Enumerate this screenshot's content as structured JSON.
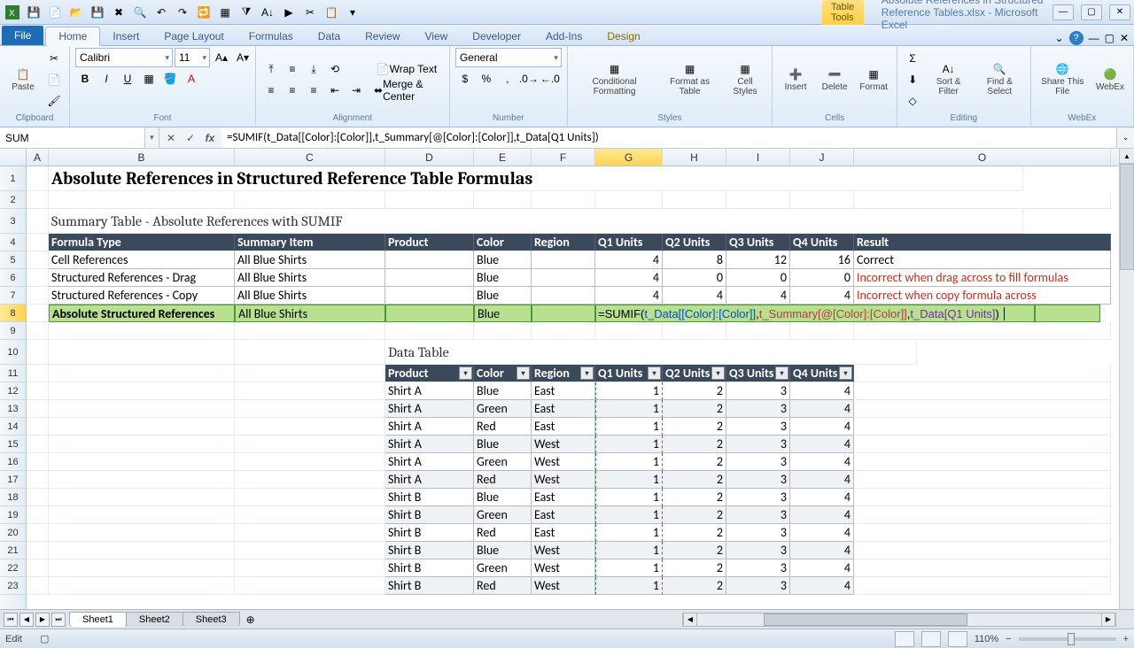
{
  "app": {
    "table_tools": "Table Tools",
    "doc_title": "Absolute References in Structured Reference Tables.xlsx - Microsoft Excel"
  },
  "tabs": {
    "file": "File",
    "home": "Home",
    "insert": "Insert",
    "page_layout": "Page Layout",
    "formulas": "Formulas",
    "data": "Data",
    "review": "Review",
    "view": "View",
    "developer": "Developer",
    "addins": "Add-Ins",
    "design": "Design"
  },
  "ribbon": {
    "clipboard": "Clipboard",
    "paste": "Paste",
    "font_group": "Font",
    "font_name": "Calibri",
    "font_size": "11",
    "alignment": "Alignment",
    "wrap": "Wrap Text",
    "merge": "Merge & Center",
    "number": "Number",
    "num_format": "General",
    "styles": "Styles",
    "cond_fmt": "Conditional\nFormatting",
    "fmt_table": "Format\nas Table",
    "cell_styles": "Cell\nStyles",
    "cells": "Cells",
    "insert": "Insert",
    "delete": "Delete",
    "format": "Format",
    "editing": "Editing",
    "sort": "Sort &\nFilter",
    "find": "Find &\nSelect",
    "webex_g": "WebEx",
    "share": "Share\nThis File",
    "webex": "WebEx"
  },
  "namebox": "SUM",
  "formula": "=SUMIF(t_Data[[Color]:[Color]],t_Summary[@[Color]:[Color]],t_Data[Q1 Units])",
  "columns": [
    "A",
    "B",
    "C",
    "D",
    "E",
    "F",
    "G",
    "H",
    "I",
    "J",
    "O"
  ],
  "title": "Absolute References in Structured Reference Table Formulas",
  "subtitle": "Summary Table - Absolute References with SUMIF",
  "summary": {
    "headers": [
      "Formula Type",
      "Summary Item",
      "Product",
      "Color",
      "Region",
      "Q1 Units",
      "Q2 Units",
      "Q3 Units",
      "Q4 Units",
      "Result"
    ],
    "rows": [
      {
        "type": "Cell References",
        "item": "All Blue Shirts",
        "product": "",
        "color": "Blue",
        "region": "",
        "q1": "4",
        "q2": "8",
        "q3": "12",
        "q4": "16",
        "result": "Correct",
        "red": false
      },
      {
        "type": "Structured References - Drag",
        "item": "All Blue Shirts",
        "product": "",
        "color": "Blue",
        "region": "",
        "q1": "4",
        "q2": "0",
        "q3": "0",
        "q4": "0",
        "result": "Incorrect when drag across to fill formulas",
        "red": true
      },
      {
        "type": "Structured References - Copy",
        "item": "All Blue Shirts",
        "product": "",
        "color": "Blue",
        "region": "",
        "q1": "4",
        "q2": "4",
        "q3": "4",
        "q4": "4",
        "result": "Incorrect when copy formula across",
        "red": true
      },
      {
        "type": "Absolute Structured References",
        "item": "All Blue Shirts",
        "product": "",
        "color": "Blue",
        "region": "",
        "q1": "",
        "q2": "",
        "q3": "",
        "q4": "",
        "result": "",
        "red": false
      }
    ]
  },
  "inline_formula": {
    "p1": "=SUMIF(",
    "p2": "t_Data[[Color]:[Color]]",
    "p3": ",",
    "p4": "t_Summary[@[Color]:[Color]]",
    "p5": ",",
    "p6": "t_Data[Q1 Units]",
    "p7": ")"
  },
  "data_title": "Data Table",
  "data_table": {
    "headers": [
      "Product",
      "Color",
      "Region",
      "Q1 Units",
      "Q2 Units",
      "Q3 Units",
      "Q4 Units"
    ],
    "rows": [
      [
        "Shirt A",
        "Blue",
        "East",
        "1",
        "2",
        "3",
        "4"
      ],
      [
        "Shirt A",
        "Green",
        "East",
        "1",
        "2",
        "3",
        "4"
      ],
      [
        "Shirt A",
        "Red",
        "East",
        "1",
        "2",
        "3",
        "4"
      ],
      [
        "Shirt A",
        "Blue",
        "West",
        "1",
        "2",
        "3",
        "4"
      ],
      [
        "Shirt A",
        "Green",
        "West",
        "1",
        "2",
        "3",
        "4"
      ],
      [
        "Shirt A",
        "Red",
        "West",
        "1",
        "2",
        "3",
        "4"
      ],
      [
        "Shirt B",
        "Blue",
        "East",
        "1",
        "2",
        "3",
        "4"
      ],
      [
        "Shirt B",
        "Green",
        "East",
        "1",
        "2",
        "3",
        "4"
      ],
      [
        "Shirt B",
        "Red",
        "East",
        "1",
        "2",
        "3",
        "4"
      ],
      [
        "Shirt B",
        "Blue",
        "West",
        "1",
        "2",
        "3",
        "4"
      ],
      [
        "Shirt B",
        "Green",
        "West",
        "1",
        "2",
        "3",
        "4"
      ],
      [
        "Shirt B",
        "Red",
        "West",
        "1",
        "2",
        "3",
        "4"
      ]
    ]
  },
  "sheets": [
    "Sheet1",
    "Sheet2",
    "Sheet3"
  ],
  "status": {
    "mode": "Edit",
    "zoom": "110%"
  }
}
